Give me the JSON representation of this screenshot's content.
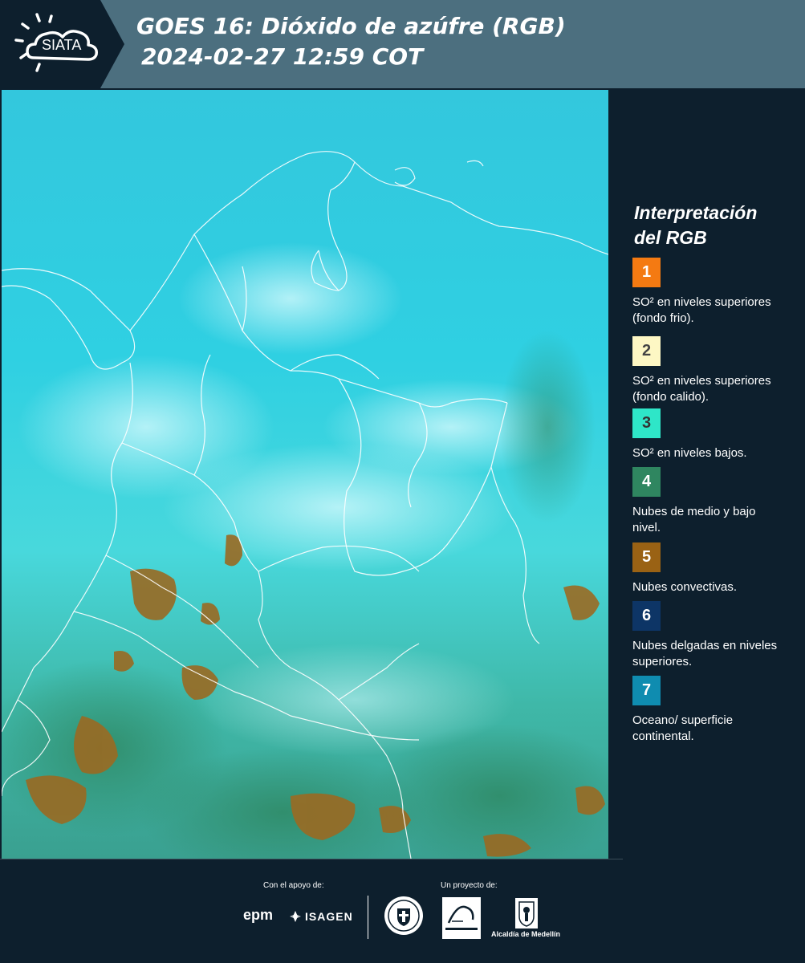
{
  "header": {
    "logo_text": "SIATA",
    "title": "GOES 16: Dióxido de azúfre (RGB)",
    "subtitle": "2024-02-27 12:59 COT"
  },
  "legend": {
    "title_line1": "Interpretación",
    "title_line2": "del RGB",
    "items": [
      {
        "number": "1",
        "label": "SO² en niveles superiores (fondo frio).",
        "color": "#f47a12",
        "text_color": "#ffffff"
      },
      {
        "number": "2",
        "label": "SO² en niveles superiores (fondo calido).",
        "color": "#fdf7c4",
        "text_color": "#444444"
      },
      {
        "number": "3",
        "label": "SO² en niveles bajos.",
        "color": "#2ee6c8",
        "text_color": "#333333"
      },
      {
        "number": "4",
        "label": "Nubes de medio y bajo nivel.",
        "color": "#2f8660",
        "text_color": "#ffffff"
      },
      {
        "number": "5",
        "label": "Nubes convectivas.",
        "color": "#9a6214",
        "text_color": "#ffffff"
      },
      {
        "number": "6",
        "label": "Nubes delgadas en niveles superiores.",
        "color": "#0d3566",
        "text_color": "#ffffff"
      },
      {
        "number": "7",
        "label": "Oceano/ superficie continental.",
        "color": "#0f8cb0",
        "text_color": "#ffffff"
      }
    ]
  },
  "footer": {
    "support_label": "Con el apoyo de:",
    "project_label": "Un proyecto de:",
    "sponsors": [
      "epm",
      "ISAGEN"
    ],
    "partners": [
      "METROPOLITANA",
      "Alcaldía de Medellín"
    ]
  },
  "colors": {
    "header_bg": "#4c6f7f",
    "panel_bg": "#0d1f2d",
    "ocean_cyan": "#2ac8dc",
    "cloud_green": "#2f8660",
    "convective_brown": "#9a6214"
  }
}
